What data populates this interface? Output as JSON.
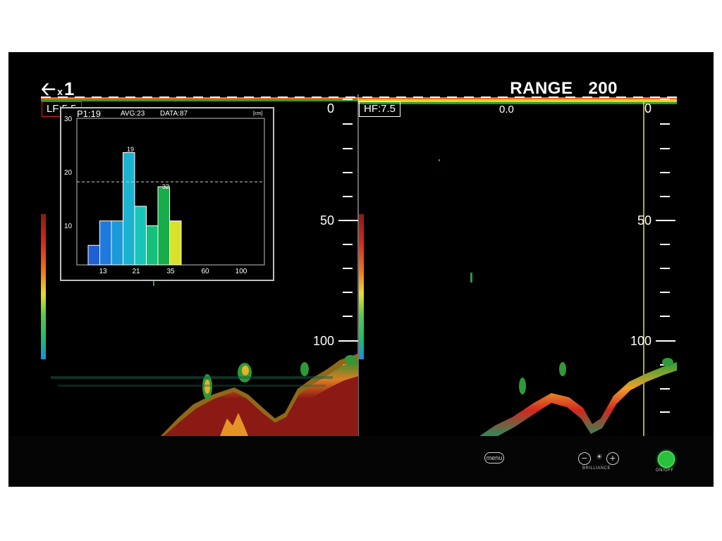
{
  "zoom": {
    "icon": "back-arrow-icon",
    "prefix": "x",
    "value": "1"
  },
  "range": {
    "label": "RANGE",
    "value": "200"
  },
  "left_panel": {
    "freq_label": "LF:5.5",
    "depth_labels": [
      "0",
      "50",
      "100"
    ]
  },
  "right_panel": {
    "freq_label": "HF:7.5",
    "meter_value": "0.0",
    "depth_labels": [
      "0",
      "50",
      "100"
    ]
  },
  "histogram": {
    "header": {
      "count": "P1:19",
      "avg": "AVG:23",
      "data": "DATA:87",
      "unit": "[cm]"
    },
    "y_ticks": [
      "30",
      "20",
      "10"
    ],
    "x_ticks": [
      "13",
      "21",
      "35",
      "60",
      "100"
    ],
    "bar_labels": [
      "19",
      "32"
    ]
  },
  "chart_data": {
    "type": "bar",
    "title": "",
    "xlabel": "",
    "ylabel": "",
    "ylim": [
      0,
      30
    ],
    "x_ticks": [
      13,
      21,
      35,
      60,
      100
    ],
    "bars": [
      {
        "value": 4,
        "color": "#1f5fd6"
      },
      {
        "value": 9,
        "color": "#1f7ae0"
      },
      {
        "value": 9,
        "color": "#1a9ad6"
      },
      {
        "value": 23,
        "color": "#1bb4d0"
      },
      {
        "value": 12,
        "color": "#17c6b8"
      },
      {
        "value": 8,
        "color": "#15c07c"
      },
      {
        "value": 16,
        "color": "#17ad4a"
      },
      {
        "value": 9,
        "color": "#d9e22a"
      }
    ],
    "reference_line": 17,
    "grid": false,
    "legend": "none"
  },
  "controls": {
    "menu_label": "menu",
    "brilliance_label": "BRILLIANCE",
    "brilliance_minus": "−",
    "brilliance_plus": "+",
    "power_label": "ON/OFF"
  },
  "colors": {
    "background": "#000000",
    "seabed": "#8b1a14",
    "power_on": "#27c13a",
    "cursor_line": "#e7e33a"
  }
}
